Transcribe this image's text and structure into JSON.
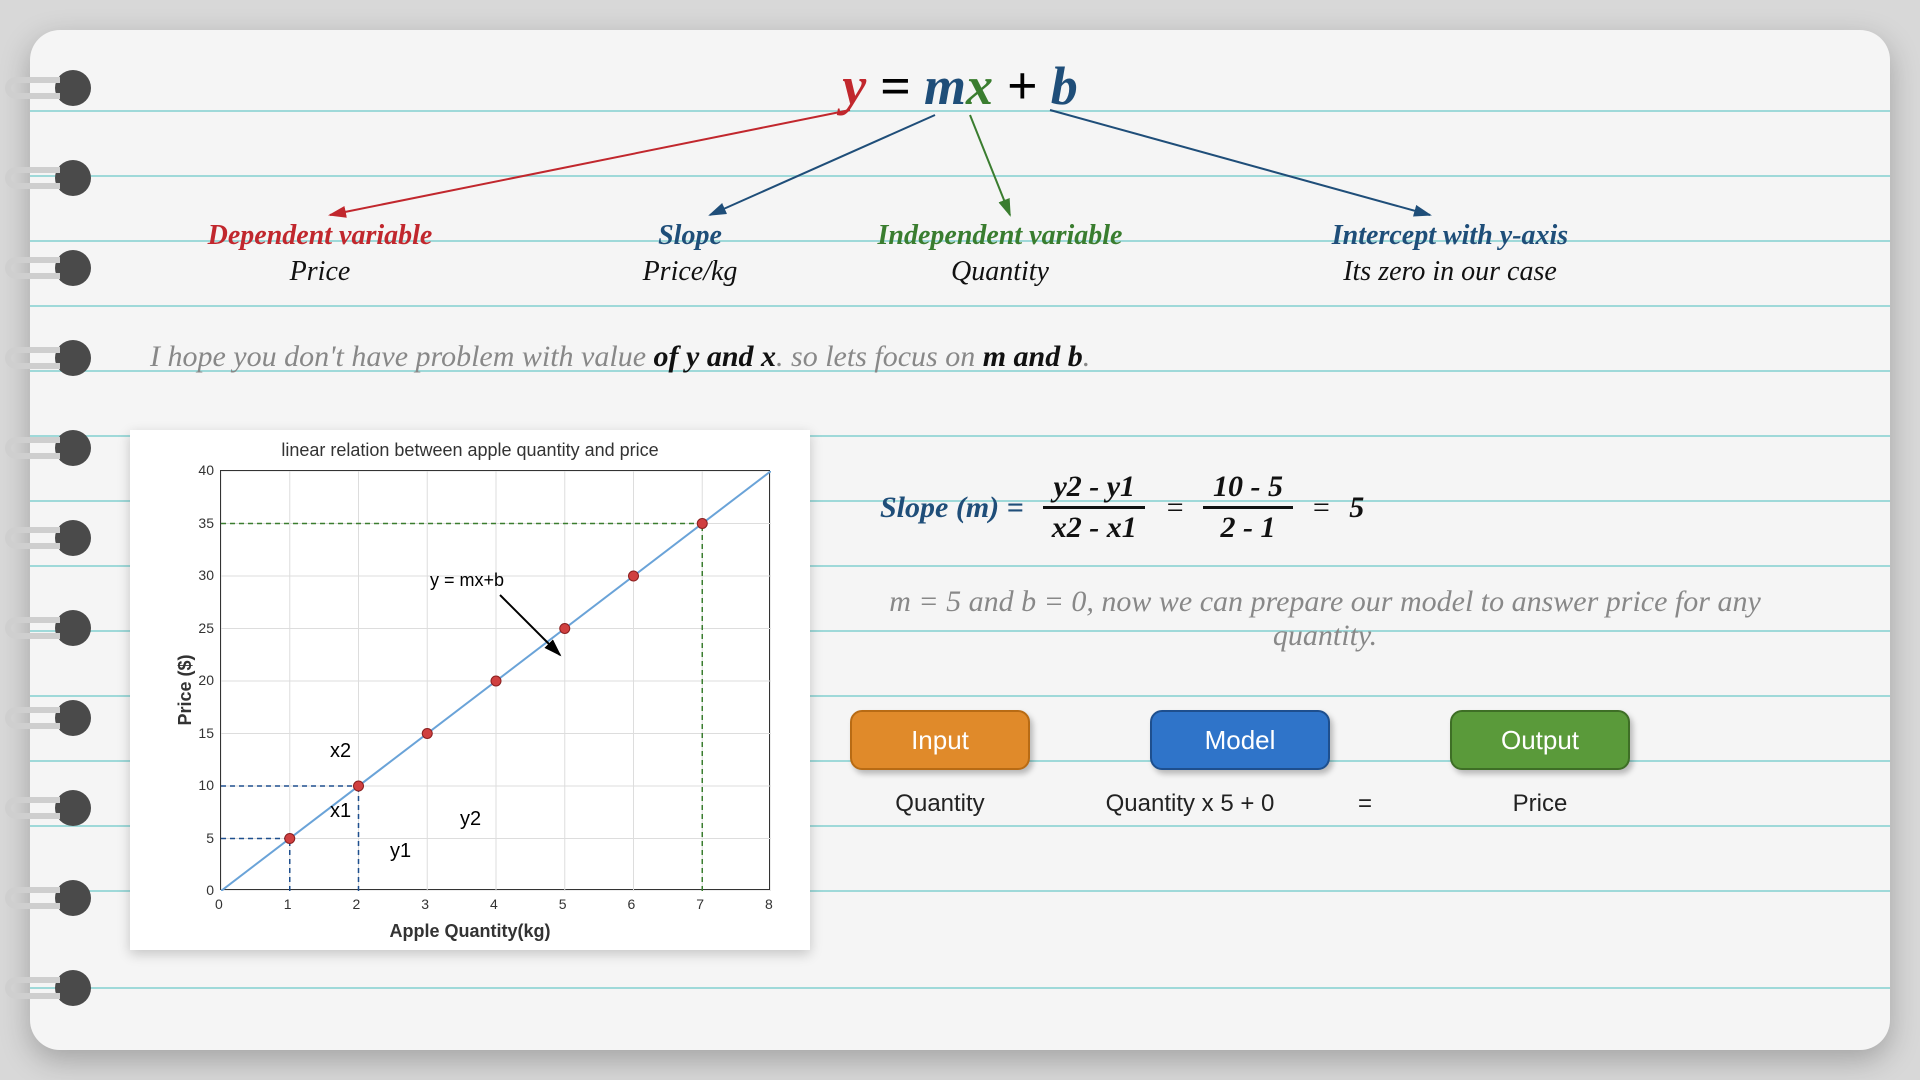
{
  "equation": {
    "y": "y",
    "eq": " = ",
    "m": "m",
    "x": "x",
    "plus": " + ",
    "b": "b"
  },
  "terms": {
    "y": {
      "title": "Dependent variable",
      "sub": "Price"
    },
    "m": {
      "title": "Slope",
      "sub": "Price/kg"
    },
    "x": {
      "title": "Independent variable",
      "sub": "Quantity"
    },
    "b": {
      "title": "Intercept with y-axis",
      "sub": "Its zero in our case"
    }
  },
  "body": {
    "line1_a": "I hope you don't have problem with value ",
    "line1_b": "of y and x",
    "line1_c": ". so lets focus on ",
    "line1_d": "m and b",
    "line1_e": ".",
    "line2": "m = 5 and b = 0, now we can prepare our model to answer price for any quantity."
  },
  "slope": {
    "label": "Slope (m) =",
    "num1": "y2 - y1",
    "den1": "x2 - x1",
    "num2": "10 - 5",
    "den2": "2 - 1",
    "result": "5"
  },
  "boxes": {
    "input": "Input",
    "model": "Model",
    "output": "Output"
  },
  "labels": {
    "input": "Quantity",
    "model": "Quantity x 5 + 0",
    "eq": "=",
    "output": "Price"
  },
  "chart_data": {
    "type": "scatter",
    "title": "linear relation between apple quantity and price",
    "xlabel": "Apple Quantity(kg)",
    "ylabel": "Price ($)",
    "x": [
      1,
      2,
      3,
      4,
      5,
      6,
      7
    ],
    "y": [
      5,
      10,
      15,
      20,
      25,
      30,
      35
    ],
    "xlim": [
      0,
      8
    ],
    "ylim": [
      0,
      40
    ],
    "xticks": [
      0,
      1,
      2,
      3,
      4,
      5,
      6,
      7,
      8
    ],
    "yticks": [
      0,
      5,
      10,
      15,
      20,
      25,
      30,
      35,
      40
    ],
    "line_annotation": "y = mx+b",
    "point_annotations": {
      "x1": "x1",
      "x2": "x2",
      "y1": "y1",
      "y2": "y2"
    },
    "reference_dashed": {
      "x1": 1,
      "y1": 5,
      "x2": 2,
      "y2": 10,
      "xmax": 7,
      "ymax": 35
    }
  }
}
